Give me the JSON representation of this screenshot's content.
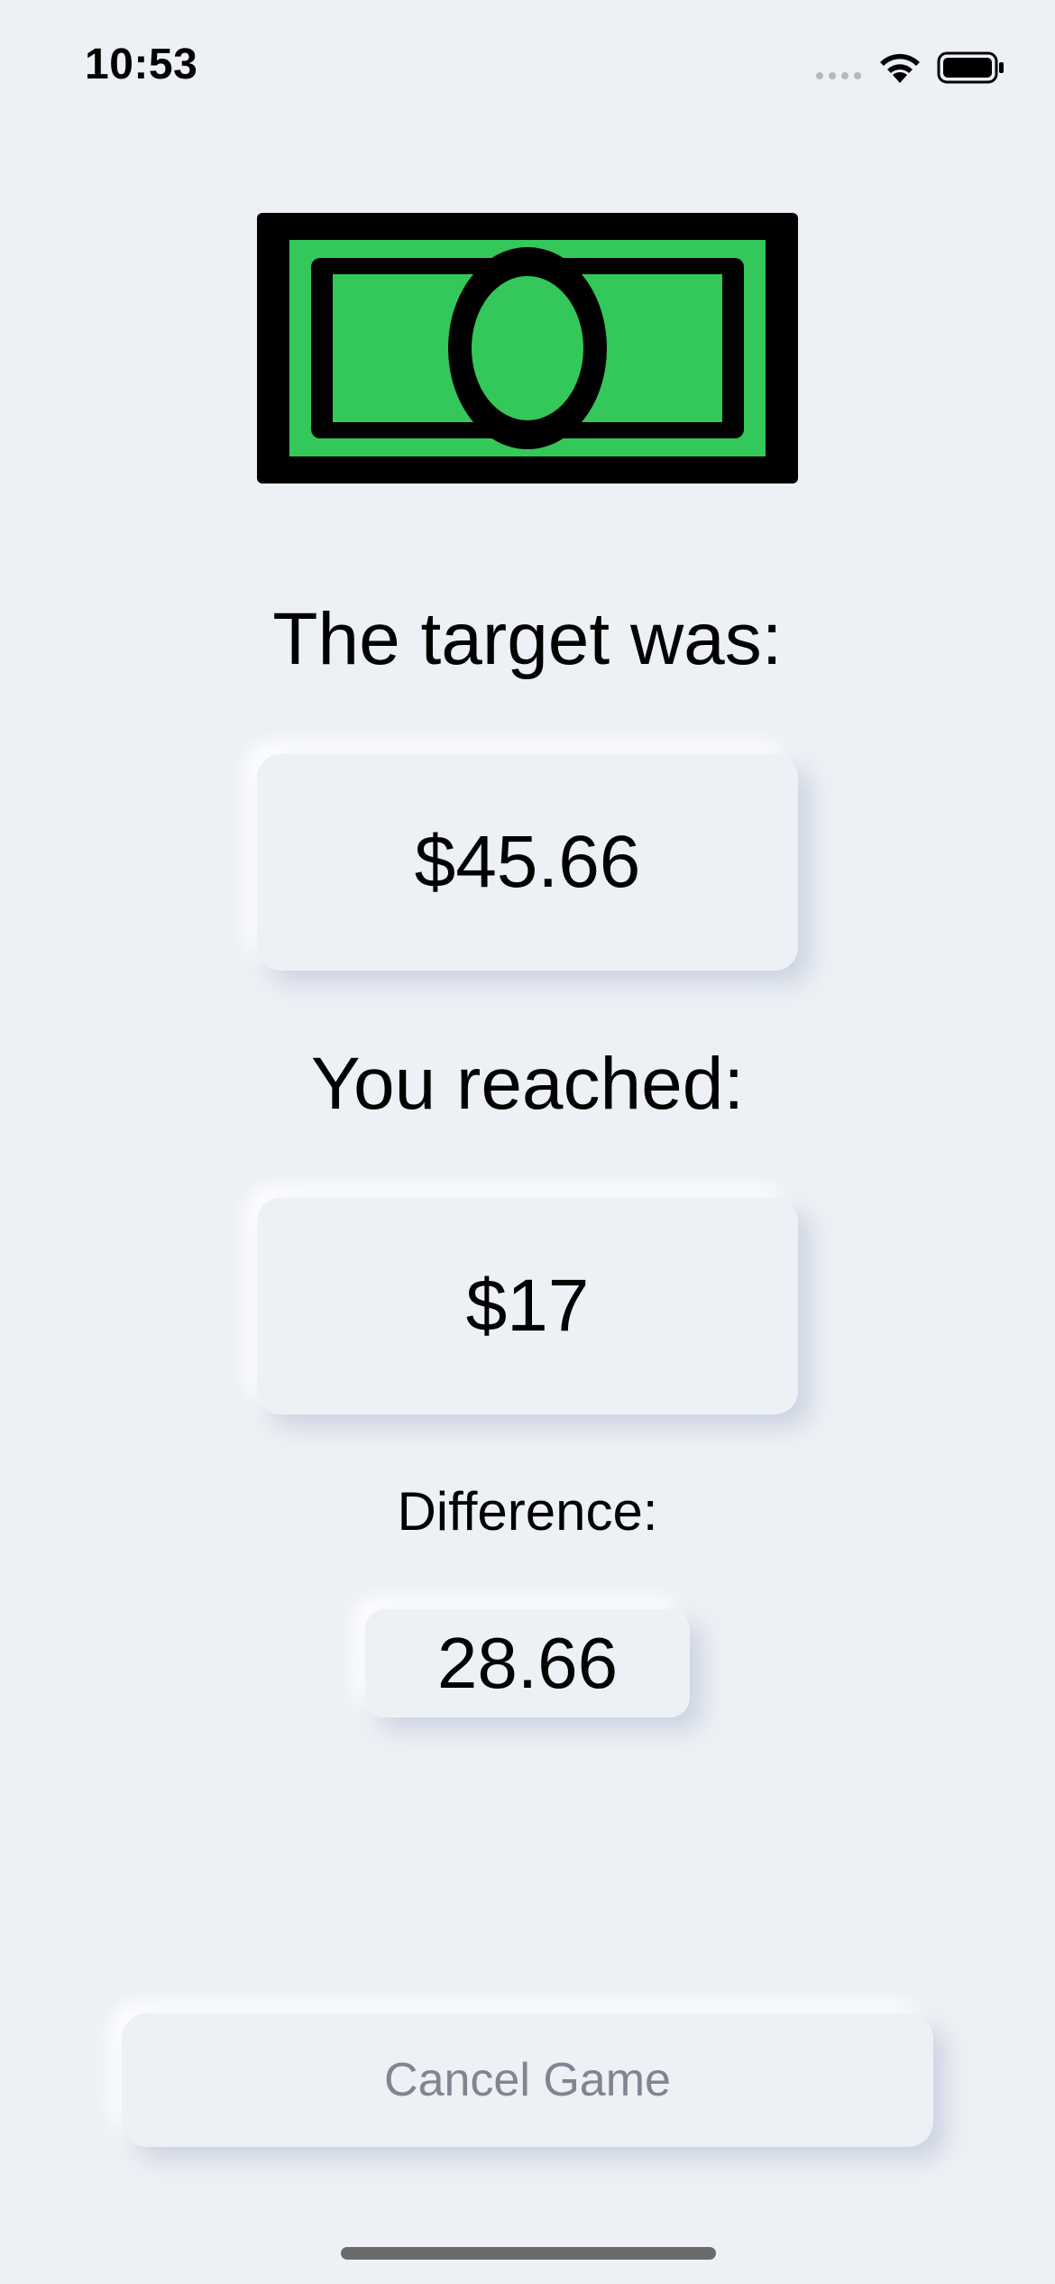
{
  "status_bar": {
    "time": "10:53",
    "icons": [
      "cellular-signal-icon",
      "wifi-icon",
      "battery-icon"
    ]
  },
  "hero": {
    "icon": "dollar-bill-icon",
    "colors": {
      "green": "#34c759",
      "outline": "#000000"
    }
  },
  "result": {
    "target_label": "The target was:",
    "target_value": "$45.66",
    "reached_label": "You reached:",
    "reached_value": "$17",
    "difference_label": "Difference:",
    "difference_value": "28.66"
  },
  "actions": {
    "cancel_label": "Cancel Game"
  },
  "theme": {
    "background": "#edf0f4",
    "muted_text": "#7f8591"
  }
}
